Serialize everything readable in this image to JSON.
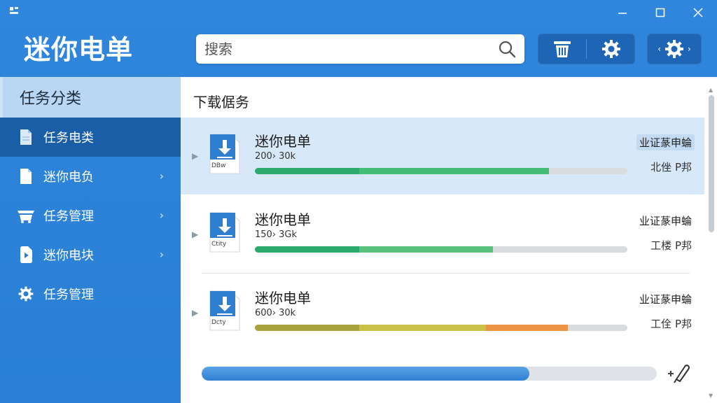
{
  "window": {
    "title": "迷你电单",
    "controls": [
      "minimize",
      "maximize",
      "close"
    ]
  },
  "search": {
    "placeholder": "搜索"
  },
  "toolbar": {
    "buttons": [
      "trash-icon",
      "gear-icon",
      "settings-nav-icon"
    ]
  },
  "sidebar": {
    "header": "任务分类",
    "items": [
      {
        "label": "任务电类",
        "icon": "document-icon",
        "has_arrow": false
      },
      {
        "label": "迷你电负",
        "icon": "file-icon",
        "has_arrow": true
      },
      {
        "label": "任务管理",
        "icon": "basket-icon",
        "has_arrow": true
      },
      {
        "label": "迷你电块",
        "icon": "media-file-icon",
        "has_arrow": true
      },
      {
        "label": "任务管理",
        "icon": "gear-icon",
        "has_arrow": false
      }
    ]
  },
  "main": {
    "title": "下载倨务",
    "tasks": [
      {
        "name": "迷你电单",
        "size": "200› 30k",
        "file_label": "DBw",
        "status": "业证蒃申蜦",
        "speed": "北侳 P邦",
        "progress": 0.79,
        "segments": [
          {
            "fraction": 0.28,
            "color": "#2aa86e"
          },
          {
            "fraction": 0.51,
            "color": "#43bd78"
          }
        ]
      },
      {
        "name": "迷你电单",
        "size": "150› 3Gk",
        "file_label": "Ctity",
        "status": "业证蒃申蜦",
        "speed": "工楼 P邦",
        "progress": 0.64,
        "segments": [
          {
            "fraction": 0.28,
            "color": "#2aa86e"
          },
          {
            "fraction": 0.36,
            "color": "#58c27d"
          }
        ]
      },
      {
        "name": "迷你电单",
        "size": "600› 30k",
        "file_label": "Dcty",
        "status": "业证蒃申蜦",
        "speed": "工佺 P邦",
        "progress": 0.84,
        "segments": [
          {
            "fraction": 0.28,
            "color": "#a8a43c"
          },
          {
            "fraction": 0.34,
            "color": "#c9c148"
          },
          {
            "fraction": 0.22,
            "color": "#ee9446"
          }
        ]
      }
    ],
    "overall_progress": 0.72
  },
  "colors": {
    "accent": "#2a7fd4",
    "sidebar_active": "#1a5ea8",
    "selected_row": "#d7e8f8"
  }
}
